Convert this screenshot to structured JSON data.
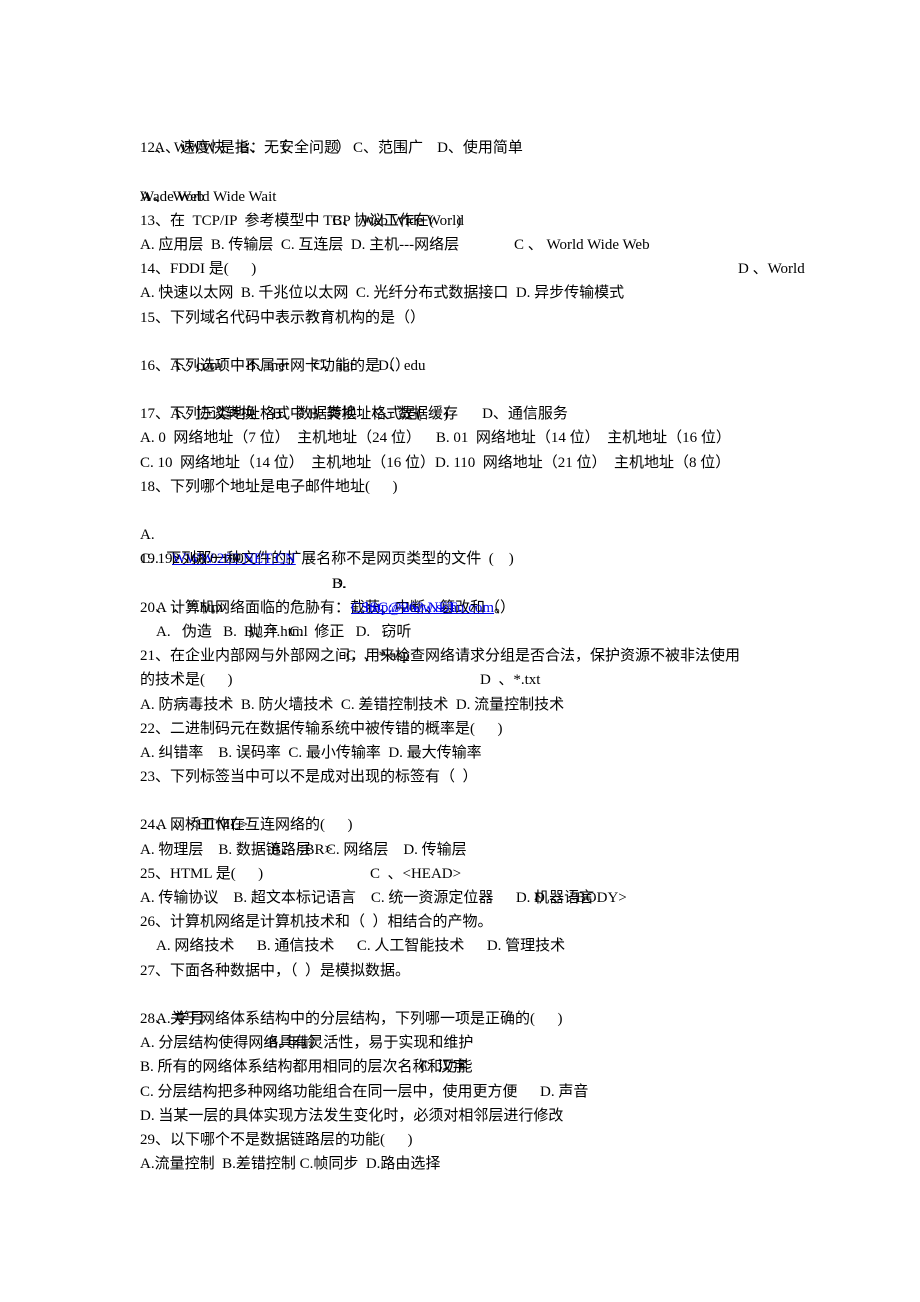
{
  "document": {
    "q11_options": {
      "a": "A、速度快",
      "b": "B、无安全问题",
      "c": "C、范围广",
      "d": "D、使用简单"
    },
    "q12": {
      "stem": "12、 WWW 是指：  （             ）",
      "a": "A 、 World Wide Wait",
      "b": "B、 Web Wide World",
      "c": "C 、 World Wide Web",
      "d": "D 、World",
      "d_cont": "Wade Web"
    },
    "q13": {
      "stem": "13、在  TCP/IP  参考模型中 TCP 协议工作在(      )",
      "options": "A. 应用层  B. 传输层  C. 互连层  D. 主机---网络层"
    },
    "q14": {
      "stem": "14、FDDI 是(      )",
      "options": "A. 快速以太网  B. 千兆位以太网  C. 光纤分布式数据接口  D. 异步传输模式"
    },
    "q15": {
      "stem": "15、下列域名代码中表示教育机构的是（）",
      "a": "A、com",
      "b": "B、net",
      "c": "C、int",
      "d": "D、edu"
    },
    "q16": {
      "stem": "16、下列选项中不属于网卡功能的是（）",
      "a": "A、协议转换",
      "b": "B、数据转换",
      "c": "C、数据缓存",
      "d": "D、通信服务"
    },
    "q17": {
      "stem": "17、下列三类地址格式中 B  类地址格式是(      )",
      "line1": "A. 0  网络地址（7 位）  主机地址（24 位）    B. 01  网络地址（14 位）  主机地址（16 位）",
      "line2": "C. 10  网络地址（14 位）  主机地址（16 位）D. 110  网络地址（21 位）  主机地址（8 位）"
    },
    "q18": {
      "stem": "18、下列哪个地址是电子邮件地址(      )",
      "a_label": "A.",
      "a_link": "WWW.263.NET.CN",
      "b_label": "B.",
      "b_link": "CSSC@263.NET",
      "c": "C. 192.168.0.100",
      "d_label": "D.",
      "d_link": "http://www.sohu.com",
      "d_suffix": "。"
    },
    "q19": {
      "stem": "19.  下列那一种文件的扩展名称不是网页类型的文件  (    )",
      "a": "A  、*.htm",
      "b": "B、*.html",
      "c": "C  、*.asp",
      "d": "D  、*.txt"
    },
    "q20": {
      "stem": "20、计算机网络面临的危胁有：截获、中断、篡改和（）",
      "options": "A.   伪造   B.   抛弃   C.   修正   D.   窃听"
    },
    "q21": {
      "stem1": "21、在企业内部网与外部网之间，用来检查网络请求分组是否合法，保护资源不被非法使用",
      "stem2": "的技术是(      )",
      "options": "A. 防病毒技术  B. 防火墙技术  C. 差错控制技术  D. 流量控制技术"
    },
    "q22": {
      "stem": "22、二进制码元在数据传输系统中被传错的概率是(      )",
      "options": "A. 纠错率    B. 误码率  C. 最小传输率  D. 最大传输率"
    },
    "q23": {
      "stem": "23、下列标签当中可以不是成对出现的标签有（  ）",
      "a": "A  、<HTML>",
      "b": "B、<BR>",
      "c": "C  、<HEAD>",
      "d": "D  、<BODY>"
    },
    "q24": {
      "stem": "24、网桥工作在互连网络的(      )",
      "options": "A. 物理层    B. 数据链路层    C. 网络层    D. 传输层"
    },
    "q25": {
      "stem": "25、HTML 是(      )",
      "options": "A. 传输协议    B. 超文本标记语言    C. 统一资源定位器      D. 机器语言"
    },
    "q26": {
      "stem": "26、计算机网络是计算机技术和（  ）相结合的产物。",
      "options": "A. 网络技术      B. 通信技术      C. 人工智能技术      D. 管理技术"
    },
    "q27": {
      "stem": "27、下面各种数据中，（  ）是模拟数据。",
      "a": "A. 学号",
      "b": "B. 年龄",
      "c": "C. 汉字",
      "d": "D. 声音"
    },
    "q28": {
      "stem": "28、关于网络体系结构中的分层结构，下列哪一项是正确的(      )",
      "a": "A. 分层结构使得网络具有灵活性，易于实现和维护",
      "b": "B. 所有的网络体系结构都用相同的层次名称和功能",
      "c": "C. 分层结构把多种网络功能组合在同一层中，使用更方便",
      "d": "D. 当某一层的具体实现方法发生变化时，必须对相邻层进行修改"
    },
    "q29": {
      "stem": "29、以下哪个不是数据链路层的功能(      )",
      "options": "A.流量控制  B.差错控制 C.帧同步  D.路由选择"
    }
  }
}
